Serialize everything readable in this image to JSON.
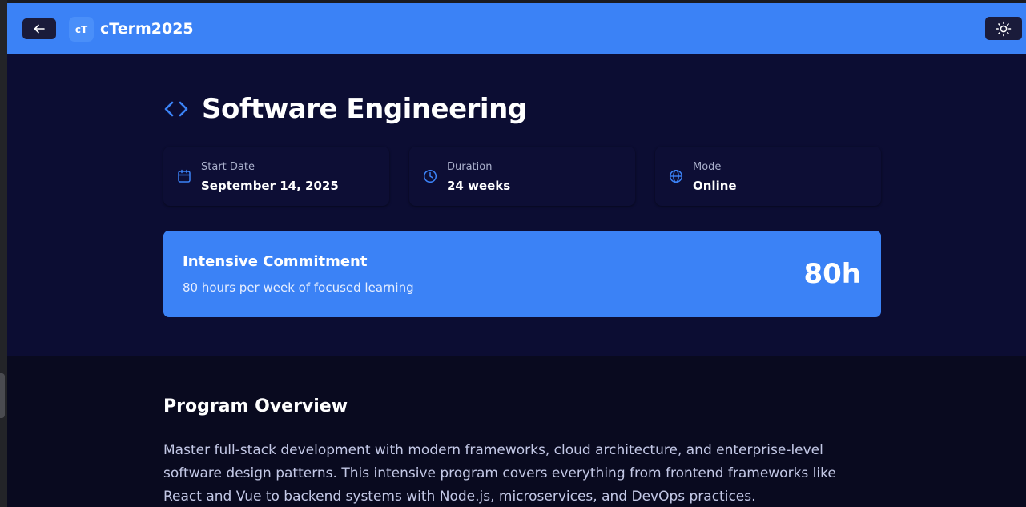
{
  "header": {
    "back_icon": "arrow-left-icon",
    "logo_text": "cT",
    "brand": "cTerm2025",
    "theme_icon": "sun-icon"
  },
  "hero": {
    "title_icon": "code-icon",
    "title": "Software Engineering",
    "stats": [
      {
        "icon": "calendar-icon",
        "label": "Start Date",
        "value": "September 14, 2025"
      },
      {
        "icon": "clock-icon",
        "label": "Duration",
        "value": "24 weeks"
      },
      {
        "icon": "globe-icon",
        "label": "Mode",
        "value": "Online"
      }
    ],
    "commitment": {
      "title": "Intensive Commitment",
      "subtitle": "80 hours per week of focused learning",
      "hours": "80h"
    }
  },
  "overview": {
    "title": "Program Overview",
    "text": "Master full-stack development with modern frameworks, cloud architecture, and enterprise-level software design patterns. This intensive program covers everything from frontend frameworks like React and Vue to backend systems with Node.js, microservices, and DevOps practices."
  },
  "colors": {
    "accent": "#3b82f6",
    "hero_bg": "#0c0d33",
    "page_bg": "#090a1f",
    "button_dark": "#1a1b3a"
  }
}
